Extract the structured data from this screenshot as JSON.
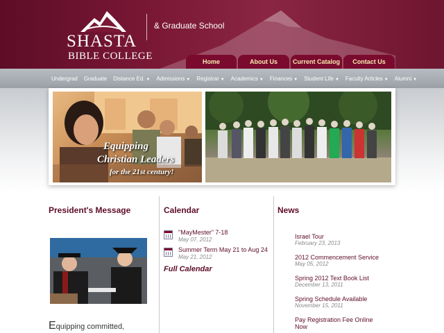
{
  "header": {
    "logo_line1": "SHASTA",
    "logo_line2": "BIBLE COLLEGE",
    "subtitle": "& Graduate School"
  },
  "top_tabs": [
    "Home",
    "About Us",
    "Current Catalog",
    "Contact Us"
  ],
  "nav": [
    {
      "label": "Undergrad",
      "dropdown": false
    },
    {
      "label": "Graduate",
      "dropdown": false
    },
    {
      "label": "Distance Ed.",
      "dropdown": true
    },
    {
      "label": "Admissions",
      "dropdown": true
    },
    {
      "label": "Registrar",
      "dropdown": true
    },
    {
      "label": "Academics",
      "dropdown": true
    },
    {
      "label": "Finances",
      "dropdown": true
    },
    {
      "label": "Student Life",
      "dropdown": true
    },
    {
      "label": "Faculty Articles",
      "dropdown": true
    },
    {
      "label": "Alumni",
      "dropdown": true
    }
  ],
  "banner": {
    "tagline1": "Equipping",
    "tagline2": "Christian Leaders",
    "tagline3": "for the 21st century!"
  },
  "president": {
    "title": "President's Message",
    "text_cap": "E",
    "text_rest": "quipping committed,"
  },
  "calendar": {
    "title": "Calendar",
    "events": [
      {
        "title": "\"MayMester\" 7-18",
        "date": "May 07, 2012"
      },
      {
        "title": "Summer Term May 21 to Aug 24",
        "date": "May 21, 2012"
      }
    ],
    "full_link": "Full Calendar"
  },
  "news": {
    "title": "News",
    "items": [
      {
        "title": "Israel Tour",
        "date": "February 23, 2013"
      },
      {
        "title": "2012 Commencement Service",
        "date": "May 05, 2012"
      },
      {
        "title": "Spring 2012 Text Book List",
        "date": "December 13, 2011"
      },
      {
        "title": "Spring Schedule Available",
        "date": "November 15, 2011"
      },
      {
        "title": "Pay Registration Fee Online Now",
        "date": ""
      }
    ]
  },
  "colors": {
    "maroon": "#5e0d27",
    "tab_bg": "#7b0b2e",
    "tab_text": "#f7e9b0",
    "nav_bg": "#a9aeb4"
  }
}
